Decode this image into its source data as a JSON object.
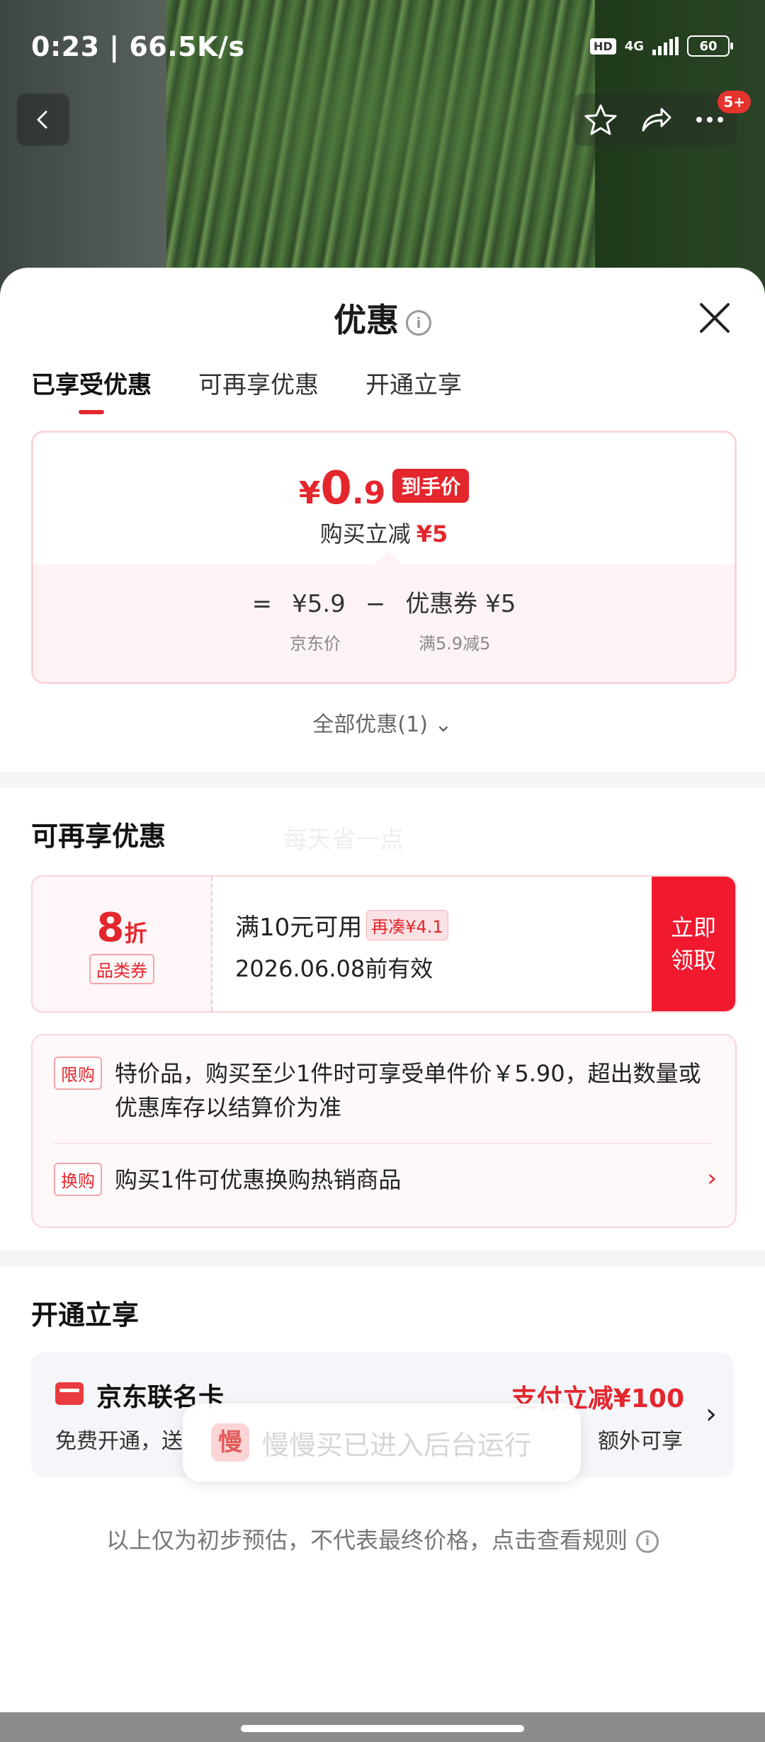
{
  "status_bar": {
    "time": "0:23 | 66.5K/s",
    "hd": "HD",
    "network": "4G",
    "battery": "60"
  },
  "top_nav": {
    "back_icon": "back-arrow-icon",
    "more_badge": "5+"
  },
  "sheet": {
    "title": "优惠",
    "info_glyph": "i",
    "tabs": [
      {
        "label": "已享受优惠"
      },
      {
        "label": "可再享优惠"
      },
      {
        "label": "开通立享"
      }
    ],
    "price_card": {
      "currency": "¥",
      "price_int": "0",
      "price_dec": ".9",
      "price_tag": "到手价",
      "sub_text": "购买立减",
      "sub_amount": "¥5",
      "formula_eq": "=",
      "formula_price": "¥5.9",
      "formula_minus": "−",
      "formula_coupon": "优惠券 ¥5",
      "label_price": "京东价",
      "label_coupon": "满5.9减5"
    },
    "all_discount": "全部优惠(1) ⌄"
  },
  "section_more": {
    "title": "可再享优惠",
    "watermark": "每天省一点",
    "coupon": {
      "discount_num": "8",
      "discount_unit": "折",
      "type": "品类券",
      "condition": "满10元可用",
      "add_tag": "再凑¥4.1",
      "expire": "2026.06.08前有效",
      "button_line1": "立即",
      "button_line2": "领取"
    },
    "special": {
      "tag1": "限购",
      "text1": "特价品，购买至少1件时可享受单件价￥5.90，超出数量或优惠库存以结算价为准",
      "tag2": "换购",
      "text2": "购买1件可优惠换购热销商品",
      "chevron": "›"
    }
  },
  "section_open": {
    "title": "开通立享",
    "card": {
      "title": "京东联名卡",
      "promo": "支付立减¥100",
      "desc_left": "免费开通，送",
      "desc_right": "额外可享",
      "chevron": "›"
    }
  },
  "toast": {
    "icon_char": "慢",
    "text": "慢慢买已进入后台运行"
  },
  "footer_note": "以上仅为初步预估，不代表最终价格，点击查看规则",
  "colors": {
    "accent": "#e4262d",
    "coupon_button": "#f0192e"
  }
}
